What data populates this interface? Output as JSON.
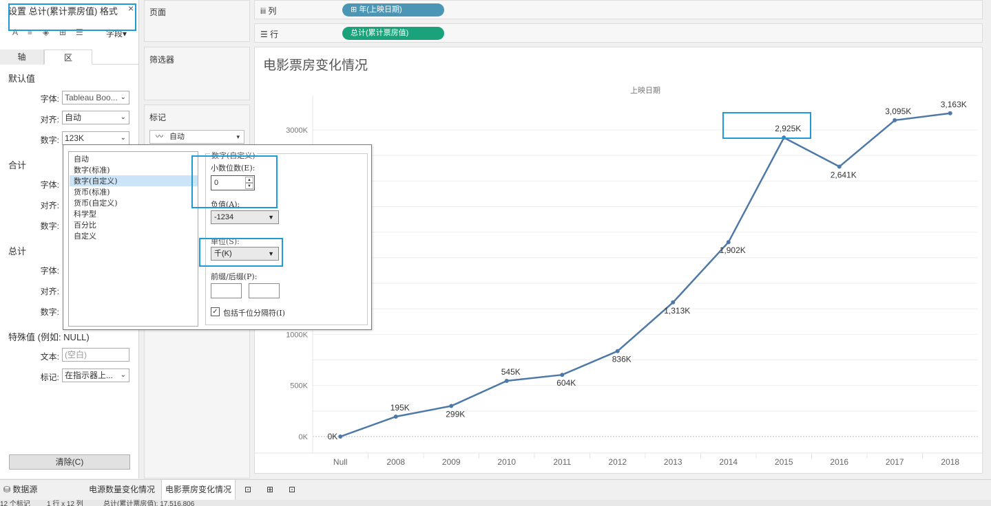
{
  "format_pane": {
    "title": "设置 总计(累计票房值) 格式",
    "close": "×",
    "field_button": "字段▾",
    "tabs": [
      "轴",
      "区"
    ],
    "default_section": "默认值",
    "font_label": "字体:",
    "align_label": "对齐:",
    "number_label": "数字:",
    "default_font": "Tableau Boo...",
    "default_align": "自动",
    "default_number": "123K",
    "total_section": "合计",
    "grand_total_section": "总计",
    "special_section": "特殊值 (例如: NULL)",
    "text_label": "文本:",
    "text_placeholder": "(空白)",
    "marks_label": "标记:",
    "marks_value": "在指示器上...",
    "clear_button": "清除(C)"
  },
  "panels": {
    "pages": "页面",
    "filters": "筛选器",
    "marks": "标记",
    "marks_type": "自动"
  },
  "shelves": {
    "columns_label": "列",
    "columns_pill": "年(上映日期)",
    "rows_label": "行",
    "rows_pill": "总计(累计票房值)",
    "columns_pill_color": "#4b96b5",
    "rows_pill_color": "#1aa37a"
  },
  "number_dialog": {
    "formats": [
      "自动",
      "数字(标准)",
      "数字(自定义)",
      "货币(标准)",
      "货币(自定义)",
      "科学型",
      "百分比",
      "自定义"
    ],
    "selected_format": "数字(自定义)",
    "group_title": "数字(自定义)",
    "decimals_label": "小数位数(E):",
    "decimals_value": "0",
    "negative_label": "负值(A):",
    "negative_value": "-1234",
    "units_label": "单位(S):",
    "units_value": "千(K)",
    "prefix_suffix_label": "前缀/后缀(P):",
    "thousands_separator_label": "包括千位分隔符(I)",
    "thousands_separator_checked": true
  },
  "chart_data": {
    "type": "line",
    "title": "电影票房变化情况",
    "xlabel": "上映日期",
    "categories": [
      "Null",
      "2008",
      "2009",
      "2010",
      "2011",
      "2012",
      "2013",
      "2014",
      "2015",
      "2016",
      "2017",
      "2018"
    ],
    "values": [
      0,
      195,
      299,
      545,
      604,
      836,
      1313,
      1902,
      2925,
      2641,
      3095,
      3163
    ],
    "value_labels": [
      "0K",
      "195K",
      "299K",
      "545K",
      "604K",
      "836K",
      "1,313K",
      "1,902K",
      "2,925K",
      "2,641K",
      "3,095K",
      "3,163K"
    ],
    "y_ticks": [
      "0K",
      "500K",
      "1000K",
      "3000K"
    ],
    "ylim": [
      0,
      3000
    ],
    "line_color": "#4e79a7",
    "grid": true
  },
  "bottom_tabs": {
    "datasource": "数据源",
    "sheet1": "电源数量变化情况",
    "sheet2": "电影票房变化情况"
  },
  "status": {
    "marks": "12 个标记",
    "rows_cols": "1 行 x 12 列",
    "sum": "总计(累计票房值): 17,516,806"
  }
}
